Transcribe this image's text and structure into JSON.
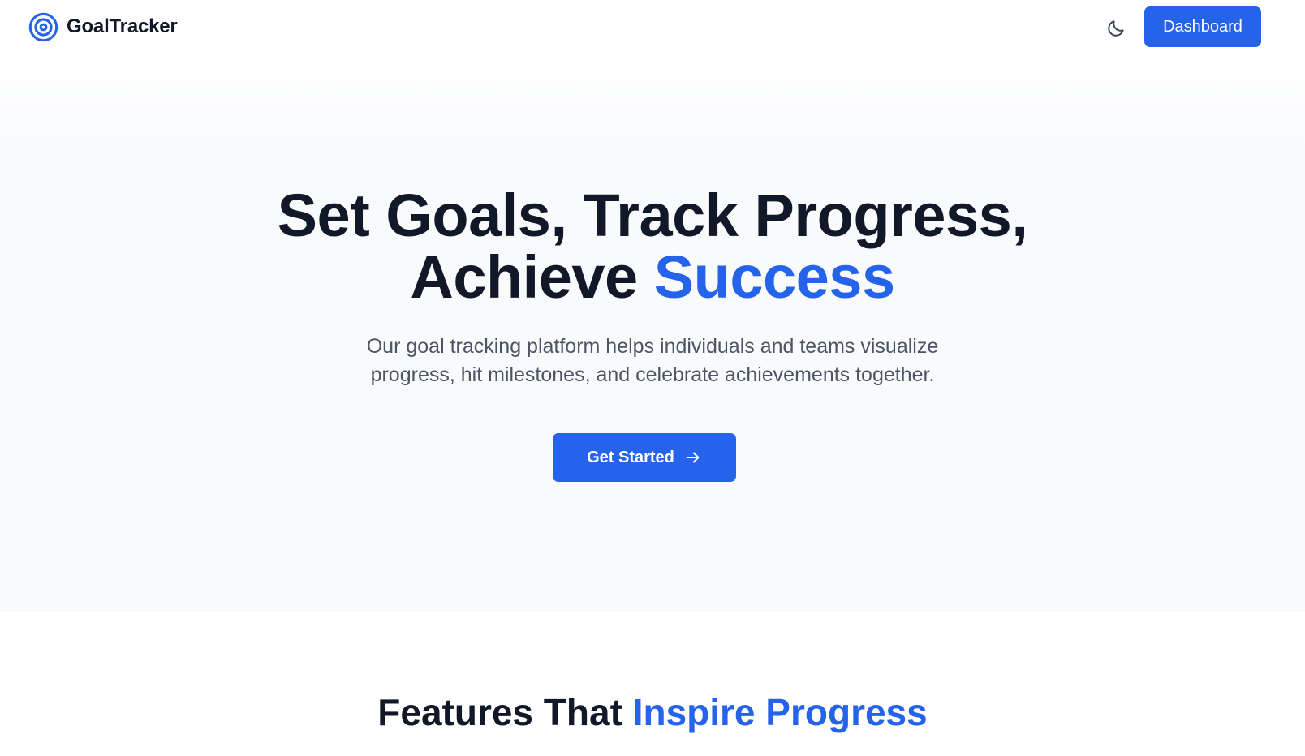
{
  "header": {
    "brand_name": "GoalTracker",
    "brand_icon": "target-icon",
    "theme_toggle_icon": "moon-icon",
    "dashboard_label": "Dashboard"
  },
  "hero": {
    "title_line1": "Set Goals, Track Progress,",
    "title_line2_plain": "Achieve ",
    "title_line2_accent": "Success",
    "subtitle": "Our goal tracking platform helps individuals and teams visualize progress, hit milestones, and celebrate achievements together.",
    "cta_label": "Get Started",
    "cta_icon": "arrow-right-icon"
  },
  "features": {
    "title_plain": "Features That ",
    "title_accent": "Inspire Progress"
  },
  "colors": {
    "accent": "#2563eb",
    "text_dark": "#111827",
    "text_muted": "#4b5563",
    "hero_bg": "#f8fafc"
  }
}
